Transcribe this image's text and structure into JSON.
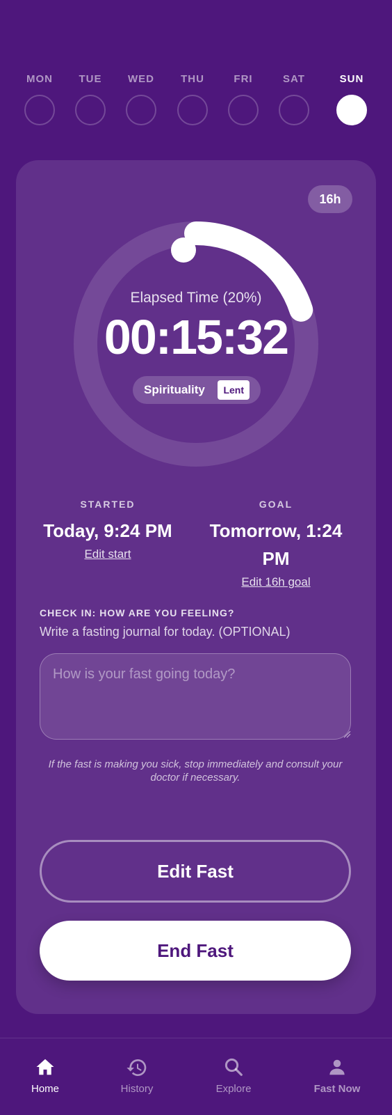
{
  "week": {
    "days": [
      {
        "label": "MON",
        "active": false
      },
      {
        "label": "TUE",
        "active": false
      },
      {
        "label": "WED",
        "active": false
      },
      {
        "label": "THU",
        "active": false
      },
      {
        "label": "FRI",
        "active": false
      },
      {
        "label": "SAT",
        "active": false
      },
      {
        "label": "SUN",
        "active": true
      }
    ]
  },
  "fast": {
    "goal_badge": "16h",
    "elapsed_label": "Elapsed Time (20%)",
    "progress_fraction": 0.2,
    "timer": "00:15:32",
    "tag": {
      "name": "Spirituality",
      "chip": "Lent"
    },
    "started": {
      "heading": "STARTED",
      "value": "Today, 9:24 PM",
      "link": "Edit start"
    },
    "goal": {
      "heading": "GOAL",
      "value": "Tomorrow, 1:24 PM",
      "link": "Edit 16h goal"
    }
  },
  "checkin": {
    "title": "CHECK IN: HOW ARE YOU FEELING?",
    "subtitle": "Write a fasting journal for today. (OPTIONAL)",
    "placeholder": "How is your fast going today?",
    "value": "",
    "warning": "If the fast is making you sick, stop immediately and consult your doctor if necessary."
  },
  "actions": {
    "edit_label": "Edit Fast",
    "end_label": "End Fast"
  },
  "nav": {
    "items": [
      {
        "label": "Home",
        "icon": "home-icon",
        "active": true
      },
      {
        "label": "History",
        "icon": "history-icon",
        "active": false
      },
      {
        "label": "Explore",
        "icon": "search-icon",
        "active": false
      },
      {
        "label": "Fast Now",
        "icon": "person-icon",
        "active": false
      }
    ]
  },
  "colors": {
    "background": "#4E177C",
    "card": "#61308A",
    "accent": "#FFFFFF"
  }
}
